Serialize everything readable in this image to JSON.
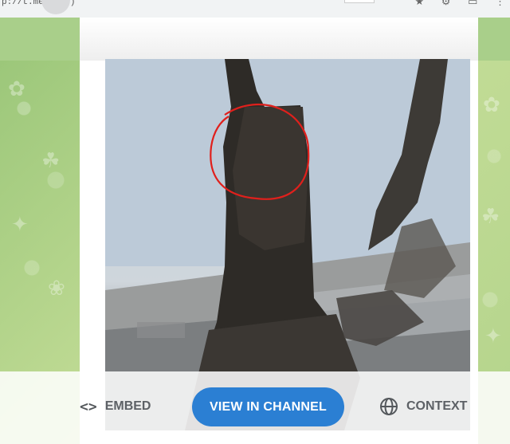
{
  "browser": {
    "url_fragment": "p://t.me/...             )",
    "icons": [
      "star-icon",
      "extension-icon",
      "window-icon",
      "menu-icon"
    ]
  },
  "post": {
    "media": {
      "type": "video",
      "annotation": "red-circle"
    }
  },
  "actions": {
    "embed_icon": "<>",
    "embed_label": "EMBED",
    "view_label": "VIEW IN CHANNEL",
    "context_label": "CONTEXT"
  },
  "colors": {
    "accent": "#2b7fd3",
    "annotation": "#e0201c",
    "wallpaper": "#a9cf8a"
  }
}
